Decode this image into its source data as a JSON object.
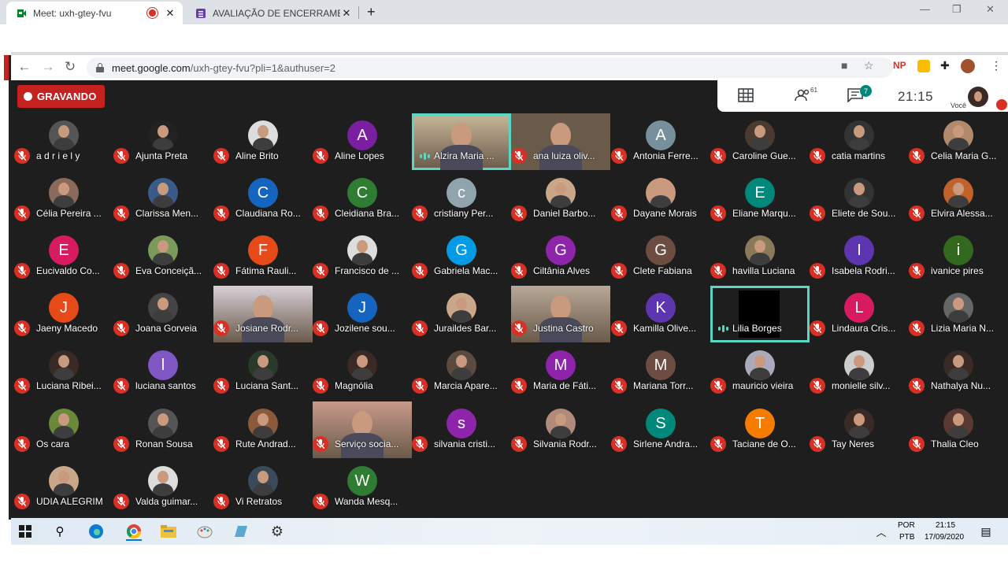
{
  "browser": {
    "tabs": [
      {
        "title": "Meet: uxh-gtey-fvu",
        "active": true
      },
      {
        "title": "AVALIAÇÃO DE ENCERRAMENTO",
        "active": false
      }
    ],
    "url_host": "meet.google.com",
    "url_path": "/uxh-gtey-fvu?pli=1&authuser=2",
    "ext_np": "NP"
  },
  "meet": {
    "recording_label": "GRAVANDO",
    "people_count": "61",
    "chat_count": "7",
    "clock": "21:15",
    "self_label": "Você",
    "participants": [
      {
        "name": "a d r i e l y",
        "type": "photo",
        "c": "#555"
      },
      {
        "name": "Ajunta Preta",
        "type": "photo",
        "c": "#222"
      },
      {
        "name": "Aline Brito",
        "type": "photo",
        "c": "#ddd"
      },
      {
        "name": "Aline Lopes",
        "type": "letter",
        "letter": "A",
        "c": "#7b1fa2"
      },
      {
        "name": "Alzira Maria ...",
        "type": "video",
        "c": "#c8b89a",
        "highlight": true
      },
      {
        "name": "ana luiza oliv...",
        "type": "video",
        "c": "#6b5b4b"
      },
      {
        "name": "Antonia Ferre...",
        "type": "letter",
        "letter": "A",
        "c": "#78909c"
      },
      {
        "name": "Caroline Gue...",
        "type": "photo",
        "c": "#4a3a30"
      },
      {
        "name": "catia martins",
        "type": "photo",
        "c": "#333"
      },
      {
        "name": "Celia Maria G...",
        "type": "photo",
        "c": "#b08a6a"
      },
      {
        "name": "Célia Pereira ...",
        "type": "photo",
        "c": "#8a6a5a"
      },
      {
        "name": "Clarissa Men...",
        "type": "photo",
        "c": "#3a5a8a"
      },
      {
        "name": "Claudiana Ro...",
        "type": "letter",
        "letter": "C",
        "c": "#1565c0"
      },
      {
        "name": "Cleidiana Bra...",
        "type": "letter",
        "letter": "C",
        "c": "#2e7d32"
      },
      {
        "name": "cristiany Per...",
        "type": "letter",
        "letter": "c",
        "c": "#90a4ae"
      },
      {
        "name": "Daniel Barbo...",
        "type": "photo",
        "c": "#c9a88a"
      },
      {
        "name": "Dayane Morais",
        "type": "photo",
        "c": "#c99a7d"
      },
      {
        "name": "Eliane Marqu...",
        "type": "letter",
        "letter": "E",
        "c": "#00897b"
      },
      {
        "name": "Eliete de Sou...",
        "type": "photo",
        "c": "#333"
      },
      {
        "name": "Elvira Alessa...",
        "type": "photo",
        "c": "#c0622a"
      },
      {
        "name": "Eucivaldo Co...",
        "type": "letter",
        "letter": "E",
        "c": "#d81b60"
      },
      {
        "name": "Eva Conceiçã...",
        "type": "photo",
        "c": "#7a9a5a"
      },
      {
        "name": "Fátima Rauli...",
        "type": "letter",
        "letter": "F",
        "c": "#e64a19"
      },
      {
        "name": "Francisco de ...",
        "type": "photo",
        "c": "#ddd"
      },
      {
        "name": "Gabriela Mac...",
        "type": "letter",
        "letter": "G",
        "c": "#039be5"
      },
      {
        "name": "Ciltânia Alves",
        "type": "letter",
        "letter": "G",
        "c": "#8e24aa"
      },
      {
        "name": "Clete Fabiana",
        "type": "letter",
        "letter": "G",
        "c": "#6d4c41"
      },
      {
        "name": "havilla Luciana",
        "type": "photo",
        "c": "#8a7a5a"
      },
      {
        "name": "Isabela Rodri...",
        "type": "letter",
        "letter": "I",
        "c": "#5e35b1"
      },
      {
        "name": "ivanice pires",
        "type": "letter",
        "letter": "i",
        "c": "#33691e"
      },
      {
        "name": "Jaeny Macedo",
        "type": "letter",
        "letter": "J",
        "c": "#e64a19"
      },
      {
        "name": "Joana Gorveia",
        "type": "photo",
        "c": "#444"
      },
      {
        "name": "Josiane Rodr...",
        "type": "video",
        "c": "#d8d0d8"
      },
      {
        "name": "Jozilene sou...",
        "type": "letter",
        "letter": "J",
        "c": "#1565c0"
      },
      {
        "name": "Juraildes Bar...",
        "type": "photo",
        "c": "#c9a88a"
      },
      {
        "name": "Justina Castro",
        "type": "video",
        "c": "#b8a898"
      },
      {
        "name": "Kamilla Olive...",
        "type": "letter",
        "letter": "K",
        "c": "#5e35b1"
      },
      {
        "name": "Lilia Borges",
        "type": "blackvideo",
        "c": "#000",
        "highlight": true
      },
      {
        "name": "Lindaura Cris...",
        "type": "letter",
        "letter": "L",
        "c": "#d81b60"
      },
      {
        "name": "Lizia Maria N...",
        "type": "photo",
        "c": "#666"
      },
      {
        "name": "Luciana Ribei...",
        "type": "photo",
        "c": "#3a2a25"
      },
      {
        "name": "luciana santos",
        "type": "letter",
        "letter": "l",
        "c": "#7e57c2"
      },
      {
        "name": "Luciana Sant...",
        "type": "photo",
        "c": "#2a3a2a"
      },
      {
        "name": "Magnólia",
        "type": "photo",
        "c": "#3a2a25"
      },
      {
        "name": "Marcia Apare...",
        "type": "photo",
        "c": "#5a4a40"
      },
      {
        "name": "Maria de Fáti...",
        "type": "letter",
        "letter": "M",
        "c": "#8e24aa"
      },
      {
        "name": "Mariana Torr...",
        "type": "letter",
        "letter": "M",
        "c": "#6d4c41"
      },
      {
        "name": "mauricio vieira",
        "type": "photo",
        "c": "#aab"
      },
      {
        "name": "monielle silv...",
        "type": "photo",
        "c": "#ccc"
      },
      {
        "name": "Nathalya Nu...",
        "type": "photo",
        "c": "#3a2a25"
      },
      {
        "name": "Os cara",
        "type": "photo",
        "c": "#6a8a3a"
      },
      {
        "name": "Ronan Sousa",
        "type": "photo",
        "c": "#555"
      },
      {
        "name": "Rute Andrad...",
        "type": "photo",
        "c": "#8a5a3a"
      },
      {
        "name": "Serviço socia...",
        "type": "video",
        "c": "#c89a8a"
      },
      {
        "name": "silvania cristi...",
        "type": "letter",
        "letter": "s",
        "c": "#8e24aa"
      },
      {
        "name": "Silvania Rodr...",
        "type": "photo",
        "c": "#b08a7a"
      },
      {
        "name": "Sirlene Andra...",
        "type": "letter",
        "letter": "S",
        "c": "#00897b"
      },
      {
        "name": "Taciane de O...",
        "type": "letter",
        "letter": "T",
        "c": "#f57c00"
      },
      {
        "name": "Tay Neres",
        "type": "photo",
        "c": "#3a2a25"
      },
      {
        "name": "Thalia Cleo",
        "type": "photo",
        "c": "#5a3a30"
      },
      {
        "name": "UDIA ALEGRIM",
        "type": "photo",
        "c": "#c9a88a"
      },
      {
        "name": "Valda guimar...",
        "type": "photo",
        "c": "#ddd"
      },
      {
        "name": "Vi Retratos",
        "type": "photo",
        "c": "#3a4a5a"
      },
      {
        "name": "Wanda Mesq...",
        "type": "letter",
        "letter": "W",
        "c": "#2e7d32"
      }
    ]
  },
  "taskbar": {
    "lang_top": "POR",
    "lang_bottom": "PTB",
    "time": "21:15",
    "date": "17/09/2020"
  }
}
